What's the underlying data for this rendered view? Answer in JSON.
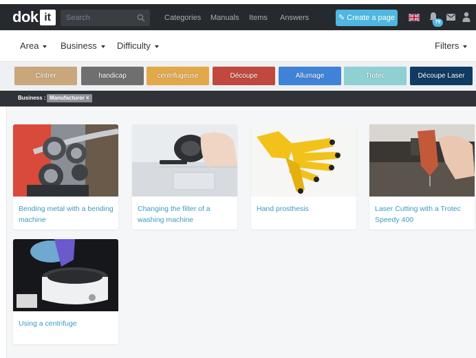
{
  "brand": {
    "logo_prefix": "dok",
    "logo_box": "it"
  },
  "search": {
    "placeholder": "Search"
  },
  "nav": [
    {
      "label": "Categories"
    },
    {
      "label": "Manuals"
    },
    {
      "label": "Items"
    },
    {
      "label": "Answers"
    }
  ],
  "create_button": {
    "icon": "pencil-icon",
    "label": "Create a page"
  },
  "user_bar": {
    "notification_count": "79",
    "language": "en-GB"
  },
  "filters": {
    "area": "Area",
    "business": "Business",
    "difficulty": "Difficulty",
    "filters": "Filters"
  },
  "tags": [
    {
      "label": "Cintrer",
      "color": "#c9a77a"
    },
    {
      "label": "handicap",
      "color": "#6f6f6f"
    },
    {
      "label": "centrifugeuse",
      "color": "#e2a84a"
    },
    {
      "label": "Découpe",
      "color": "#c0483d"
    },
    {
      "label": "Allumage",
      "color": "#3f83d8"
    },
    {
      "label": "Trotec",
      "color": "#8fd0d2"
    },
    {
      "label": "Découpe Laser",
      "color": "#0f3b63"
    }
  ],
  "active_filter": {
    "label": "Business :",
    "value": "Manufacturer",
    "remove": "×"
  },
  "cards": [
    {
      "title": "Bending metal with a bending machine"
    },
    {
      "title": "Changing the filter of a washing machine"
    },
    {
      "title": "Hand prosthesis"
    },
    {
      "title": "Laser Cutting with a Trotec Speedy 400"
    },
    {
      "title": "Using a centrifuge"
    }
  ],
  "colors": {
    "accent": "#4fb7e0",
    "link": "#3d99c3",
    "topbar": "#26292d"
  }
}
